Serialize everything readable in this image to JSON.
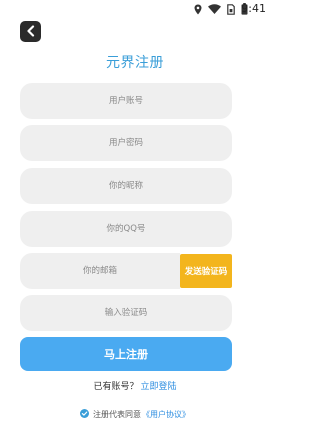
{
  "status_bar": {
    "time": "9:41",
    "icons": [
      "location-icon",
      "wifi-icon",
      "sim-icon",
      "battery-icon"
    ]
  },
  "header": {
    "back_icon": "chevron-left-icon",
    "title": "元界注册"
  },
  "form": {
    "username_placeholder": "用户账号",
    "password_placeholder": "用户密码",
    "nickname_placeholder": "你的昵称",
    "qq_placeholder": "你的QQ号",
    "email_placeholder": "你的邮箱",
    "send_code_label": "发送验证码",
    "code_placeholder": "输入验证码",
    "submit_label": "马上注册"
  },
  "footer": {
    "have_account_text": "已有账号？",
    "login_link": "立即登陆",
    "agree_text": "注册代表同意",
    "agreement_link": "《用户协议》"
  },
  "colors": {
    "title": "#3a9ed8",
    "primary_button": "#4aaaf1",
    "send_code_button": "#f3b51d",
    "field_background": "#efefef",
    "link": "#2e8ee0"
  }
}
